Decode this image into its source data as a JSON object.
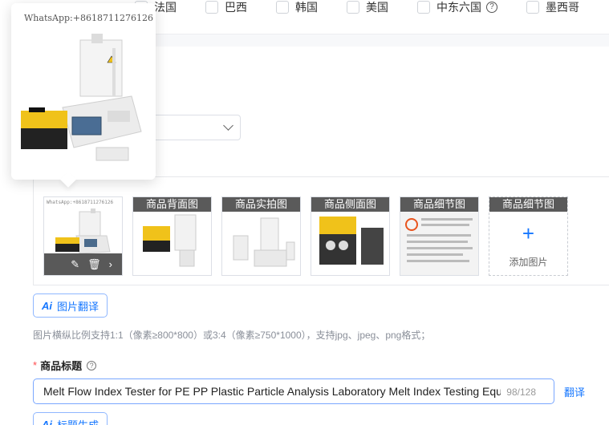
{
  "countries": [
    {
      "label": "法国"
    },
    {
      "label": "巴西"
    },
    {
      "label": "韩国"
    },
    {
      "label": "美国"
    },
    {
      "label": "中东六国",
      "help": "?"
    },
    {
      "label": "墨西哥"
    }
  ],
  "popover": {
    "watermark": "WhatsApp:+8618711276126"
  },
  "gallery": {
    "main_watermark": "WhatsApp:+8618711276126",
    "main_actions": [
      "✎",
      "🗑",
      "›"
    ],
    "slots": [
      {
        "caption": "商品背面图"
      },
      {
        "caption": "商品实拍图"
      },
      {
        "caption": "商品侧面图"
      },
      {
        "caption": "商品细节图"
      },
      {
        "caption": "商品细节图",
        "add_label": "添加图片",
        "plus": "+"
      }
    ]
  },
  "buttons": {
    "image_translate": {
      "ai": "Ai",
      "label": "图片翻译"
    },
    "title_generate": {
      "ai": "Ai",
      "label": "标题生成"
    }
  },
  "hint": "图片横纵比例支持1:1（像素≥800*800）或3:4（像素≥750*1000），支持jpg、jpeg、png格式；",
  "title_field": {
    "required_mark": "*",
    "label": "商品标题",
    "help": "?",
    "value": "Melt Flow Index Tester for PE PP Plastic Particle Analysis Laboratory Melt Index Testing Equipment",
    "count": "98/128",
    "translate": "翻译"
  },
  "colors": {
    "accent": "#1677ff",
    "required": "#ff4d4f",
    "caption_bg": "#5a5a5a"
  }
}
